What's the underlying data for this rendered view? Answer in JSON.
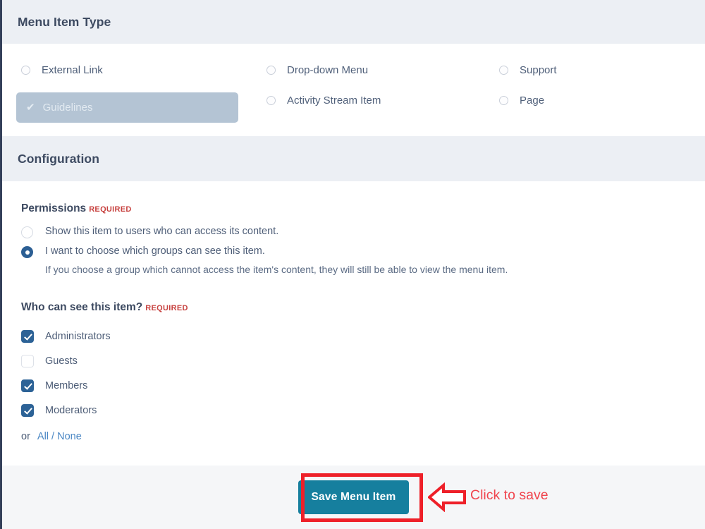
{
  "menu_item_type": {
    "header": "Menu Item Type",
    "options": [
      {
        "label": "External Link",
        "state": "unselected",
        "column": 1
      },
      {
        "label": "Drop-down Menu",
        "state": "unselected",
        "column": 2
      },
      {
        "label": "Support",
        "state": "unselected",
        "column": 3
      },
      {
        "label": "Guidelines",
        "state": "selected",
        "column": 1
      },
      {
        "label": "Activity Stream Item",
        "state": "unselected",
        "column": 2
      },
      {
        "label": "Page",
        "state": "unselected",
        "column": 3
      }
    ],
    "selected_label": "Guidelines",
    "selected_check_glyph": "✔"
  },
  "configuration": {
    "header": "Configuration",
    "permissions": {
      "title": "Permissions",
      "required_badge": "REQUIRED",
      "choices": [
        {
          "label": "Show this item to users who can access its content.",
          "selected": false,
          "help": ""
        },
        {
          "label": "I want to choose which groups can see this item.",
          "selected": true,
          "help": "If you choose a group which cannot access the item's content, they will still be able to view the menu item."
        }
      ]
    },
    "who_can_see": {
      "title": "Who can see this item?",
      "required_badge": "REQUIRED",
      "groups": [
        {
          "label": "Administrators",
          "checked": true
        },
        {
          "label": "Guests",
          "checked": false
        },
        {
          "label": "Members",
          "checked": true
        },
        {
          "label": "Moderators",
          "checked": true
        }
      ],
      "or_text": "or",
      "all_none_link": "All / None"
    }
  },
  "footer": {
    "save_label": "Save Menu Item"
  },
  "annotation": {
    "text": "Click to save",
    "arrow_direction": "left",
    "box_color": "#ee2029",
    "text_color": "#f0444d"
  },
  "colors": {
    "section_header_bg": "#eceff4",
    "header_text": "#3d4a61",
    "body_text": "#4d5d77",
    "required_red": "#c7413f",
    "selected_pill_bg": "#b4c4d4",
    "checkbox_blue": "#2c6296",
    "radio_blue": "#2c5f94",
    "link_blue": "#4a87c4",
    "save_button_teal": "#167f9e",
    "footer_bg": "#f5f6f8",
    "left_border": "#34405a"
  }
}
